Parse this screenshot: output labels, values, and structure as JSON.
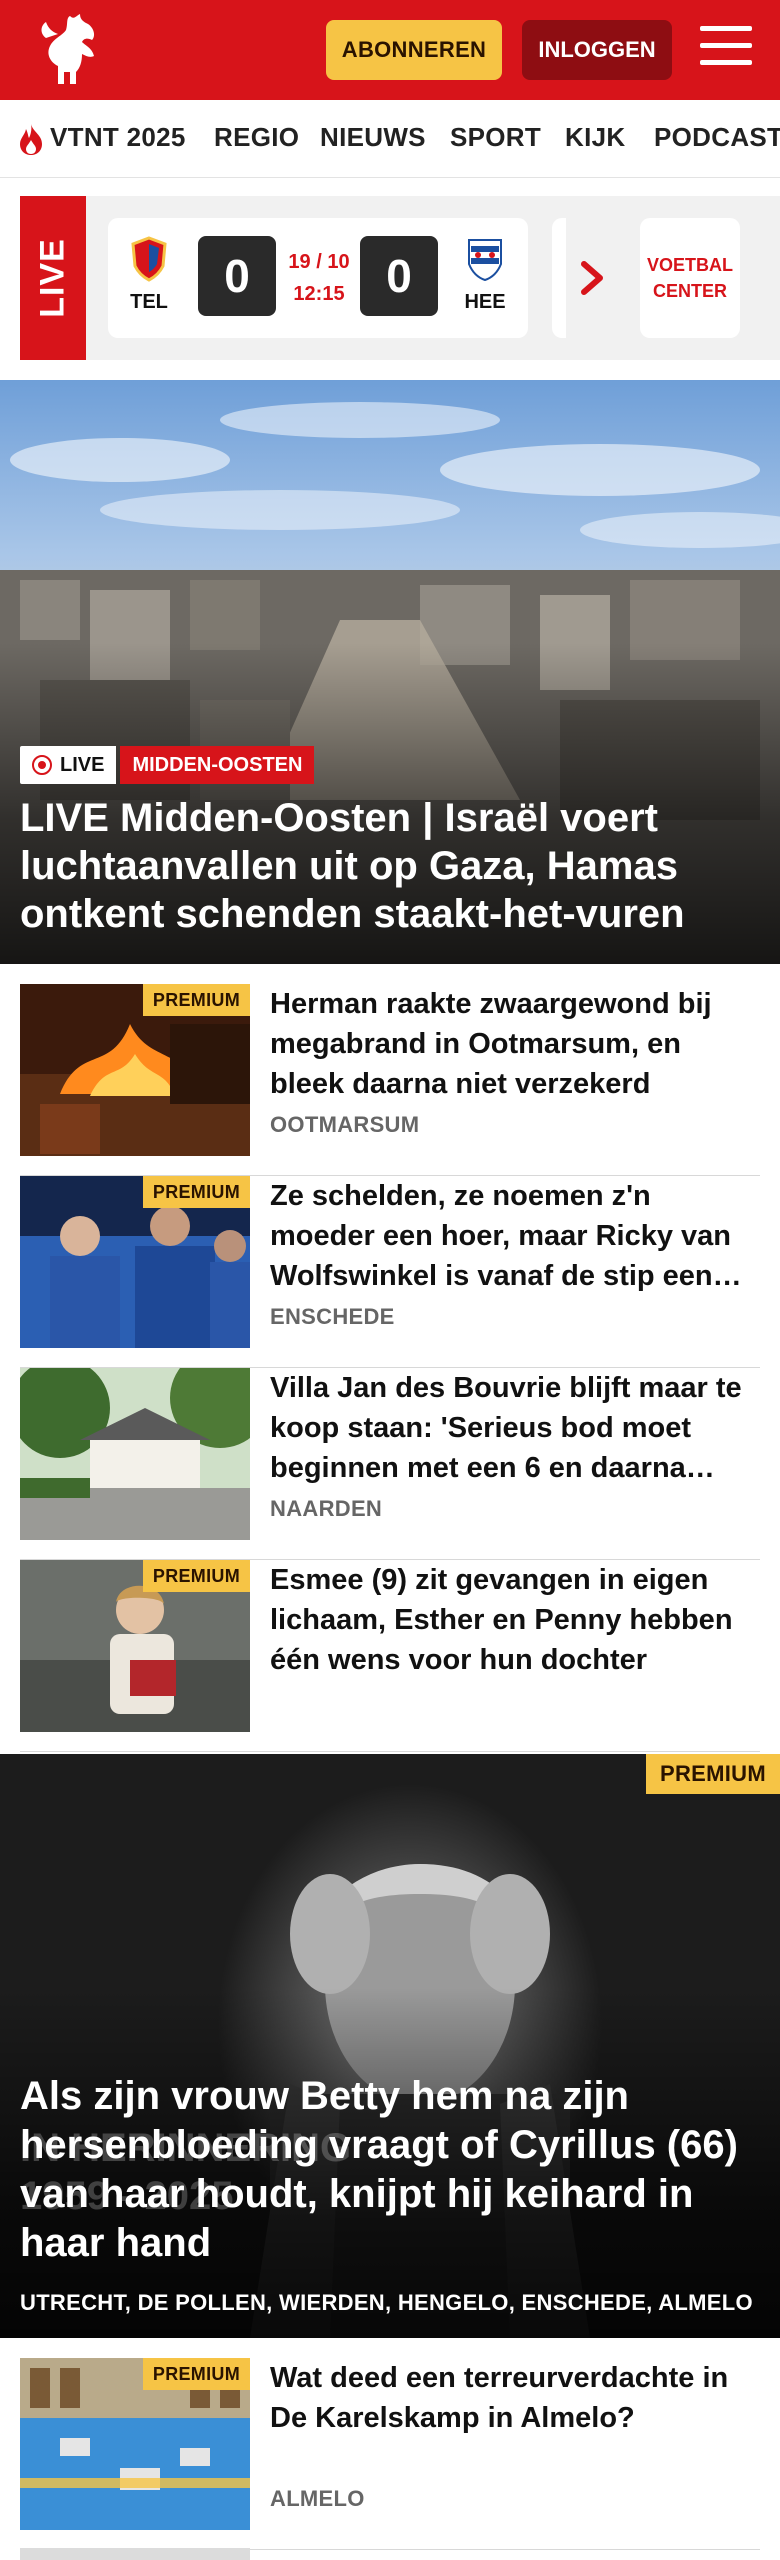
{
  "header": {
    "subscribe_label": "ABONNEREN",
    "login_label": "INLOGGEN"
  },
  "nav": {
    "items": [
      "VTNT 2025",
      "REGIO",
      "NIEUWS",
      "SPORT",
      "KIJK",
      "PODCAST"
    ]
  },
  "live_scores": {
    "live_label": "LIVE",
    "match": {
      "home_code": "TEL",
      "home_score": "0",
      "date": "19 / 10",
      "time": "12:15",
      "away_score": "0",
      "away_code": "HEE"
    },
    "football_center_label": "VOETBAL CENTER"
  },
  "hero": {
    "live_badge": "LIVE",
    "category": "MIDDEN-OOSTEN",
    "title": "LIVE Midden-Oosten | Israël voert luchtaanvallen uit op Gaza, Hamas ontkent schenden staakt-het-vuren"
  },
  "articles": [
    {
      "premium": "PREMIUM",
      "title": "Herman raakte zwaargewond bij megabrand in Ootmarsum, en bleek daarna niet verzekerd",
      "location": "OOTMARSUM"
    },
    {
      "premium": "PREMIUM",
      "title": "Ze schelden, ze noemen z'n moeder een hoer, maar Ricky van Wolfswinkel is vanaf de stip een…",
      "location": "ENSCHEDE"
    },
    {
      "premium": "",
      "title": "Villa Jan des Bouvrie blijft maar te koop staan: 'Serieus bod moet beginnen met een 6 en daarna…",
      "location": "NAARDEN"
    },
    {
      "premium": "PREMIUM",
      "title": "Esmee (9) zit gevangen in eigen lichaam, Esther en Penny hebben één wens voor hun dochter",
      "location": ""
    }
  ],
  "feature": {
    "premium": "PREMIUM",
    "ghost_line1": "IN HERINNERING",
    "ghost_line2": "1959 - 2025",
    "title": "Als zijn vrouw Betty hem na zijn hersenbloeding vraagt of Cyrillus (66) van haar houdt, knijpt hij keihard in haar hand",
    "locations": "UTRECHT, DE POLLEN, WIERDEN, HENGELO, ENSCHEDE, ALMELO"
  },
  "article_bottom": {
    "premium": "PREMIUM",
    "title": "Wat deed een terreurverdachte in De Karelskamp in Almelo?",
    "location": "ALMELO"
  },
  "colors": {
    "brand_red": "#d7141a",
    "premium_yellow": "#f6c445",
    "login_dark_red": "#8e0d12"
  }
}
